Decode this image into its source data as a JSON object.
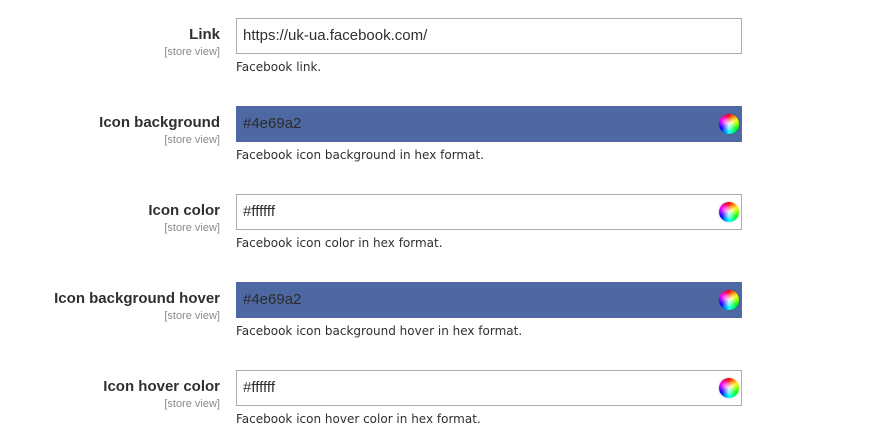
{
  "fields": [
    {
      "label": "Link",
      "scope": "[store view]",
      "value": "https://uk-ua.facebook.com/",
      "note": "Facebook link.",
      "background": "#ffffff",
      "has_color_picker": false
    },
    {
      "label": "Icon background",
      "scope": "[store view]",
      "value": "#4e69a2",
      "note": "Facebook icon background in hex format.",
      "background": "#4e69a2",
      "has_color_picker": true
    },
    {
      "label": "Icon color",
      "scope": "[store view]",
      "value": "#ffffff",
      "note": "Facebook icon color in hex format.",
      "background": "#ffffff",
      "has_color_picker": true
    },
    {
      "label": "Icon background hover",
      "scope": "[store view]",
      "value": "#4e69a2",
      "note": "Facebook icon background hover in hex format.",
      "background": "#4e69a2",
      "has_color_picker": true
    },
    {
      "label": "Icon hover color",
      "scope": "[store view]",
      "value": "#ffffff",
      "note": "Facebook icon hover color in hex format.",
      "background": "#ffffff",
      "has_color_picker": true
    }
  ],
  "icons": {
    "color_picker": "color-wheel-icon"
  }
}
